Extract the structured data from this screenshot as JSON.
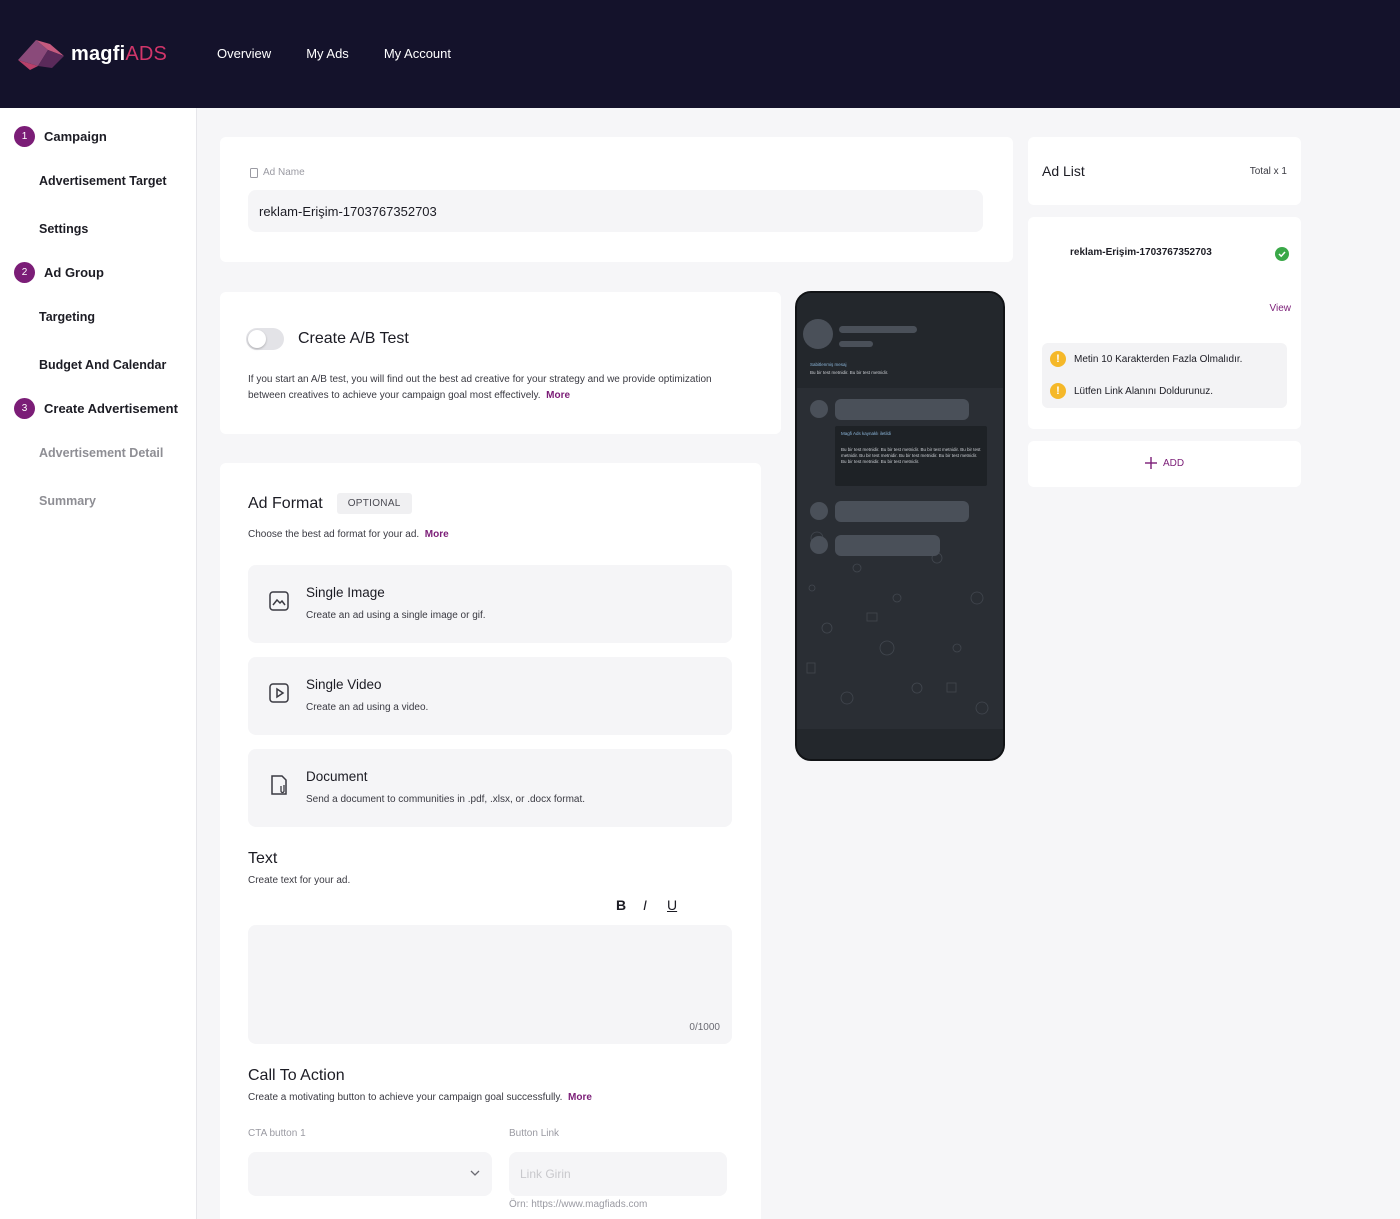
{
  "header": {
    "logo": {
      "main": "magfi",
      "accent": "ADS"
    },
    "nav": [
      "Overview",
      "My Ads",
      "My Account"
    ]
  },
  "sidebar": {
    "steps": [
      {
        "num": "1",
        "label": "Campaign"
      },
      {
        "num": "2",
        "label": "Ad Group"
      },
      {
        "num": "3",
        "label": "Create Advertisement"
      }
    ],
    "substeps": {
      "advertisement_target": "Advertisement Target",
      "settings": "Settings",
      "targeting": "Targeting",
      "budget_calendar": "Budget And Calendar",
      "advertisement_detail": "Advertisement Detail",
      "summary": "Summary"
    }
  },
  "ad_name": {
    "label": "Ad Name",
    "value": "reklam-Erişim-1703767352703"
  },
  "ab_test": {
    "title": "Create A/B Test",
    "enabled": false,
    "description": "If you start an A/B test, you will find out the best ad creative for your strategy and we provide optimization between creatives to achieve your campaign goal most effectively.",
    "more": "More"
  },
  "ad_format": {
    "title": "Ad Format",
    "badge": "OPTIONAL",
    "description": "Choose the best ad format for your ad.",
    "more": "More",
    "options": [
      {
        "title": "Single Image",
        "desc": "Create an ad using a single image or gif.",
        "icon": "image-icon"
      },
      {
        "title": "Single Video",
        "desc": "Create an ad using a video.",
        "icon": "video-icon"
      },
      {
        "title": "Document",
        "desc": "Send a document to communities in .pdf, .xlsx, or .docx format.",
        "icon": "document-icon"
      }
    ]
  },
  "text_section": {
    "title": "Text",
    "description": "Create text for your ad.",
    "bold": "B",
    "italic": "I",
    "underline": "U",
    "counter": "0/1000"
  },
  "cta": {
    "title": "Call To Action",
    "description": "Create a motivating button to achieve your campaign goal successfully.",
    "more": "More",
    "button_label": "CTA button 1",
    "link_label": "Button Link",
    "link_placeholder": "Link Girin",
    "link_hint": "Örn: https://www.magfiads.com"
  },
  "preview": {
    "pinned_title": "Sabitlenmiş mesaj",
    "pinned_text": "Bu bir test metnidir. Bu bir test metnidir.",
    "bubble_title": "Magfi Ads kaynaklı iletildi",
    "bubble_text": "Bu bir test metnidir. Bu bir test metnidir. Bu bir test metnidir. Bu bir test metnidir. Bu bir test metnidir. Bu bir test metnidir. Bu bir test metnidir. Bu bir test metnidir. Bu bir test metnidir."
  },
  "ad_list": {
    "title": "Ad List",
    "total": "Total x 1",
    "item_name": "reklam-Erişim-1703767352703",
    "view": "View",
    "warnings": [
      "Metin 10 Karakterden Fazla Olmalıdır.",
      "Lütfen Link Alanını Doldurunuz."
    ],
    "add": "ADD"
  },
  "colors": {
    "header_bg": "#14122b",
    "accent": "#7b1d77",
    "warning": "#f5b829",
    "success": "#3aa848"
  }
}
